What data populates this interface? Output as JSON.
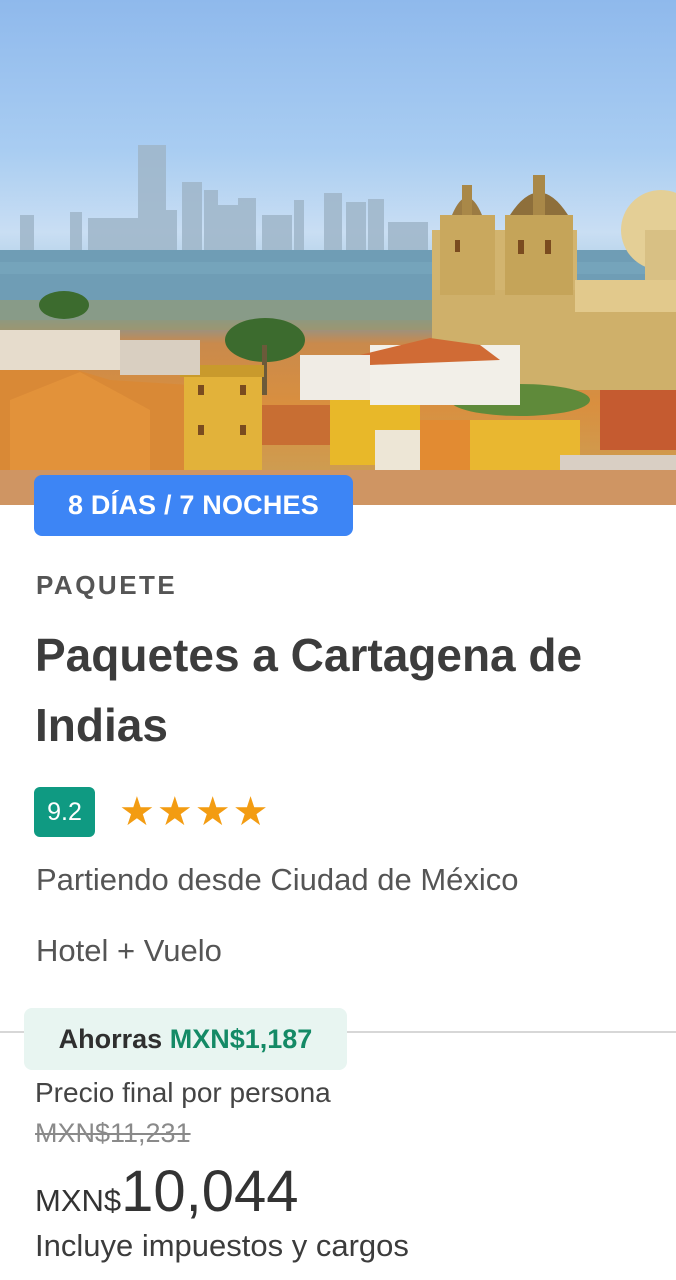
{
  "hero": {
    "image": "cartagena-skyline-photo"
  },
  "badge": {
    "duration": "8 DÍAS / 7 NOCHES"
  },
  "card": {
    "category": "PAQUETE",
    "title": "Paquetes a Cartagena de Indias",
    "rating": {
      "score": "9.2",
      "stars": 4,
      "star_char": "★"
    },
    "origin": "Partiendo desde Ciudad de México",
    "product": "Hotel + Vuelo"
  },
  "pricing": {
    "savings_label": "Ahorras",
    "savings_amount": "MXN$1,187",
    "price_label": "Precio final por persona",
    "old_price": "MXN$11,231",
    "currency": "MXN$",
    "price": "10,044",
    "taxes_note": "Incluye impuestos y cargos"
  },
  "colors": {
    "badge_blue": "#3d85f5",
    "score_green": "#0f9a82",
    "star_orange": "#f39c12",
    "savings_green": "#148a66",
    "savings_bg": "#e8f5f1"
  }
}
